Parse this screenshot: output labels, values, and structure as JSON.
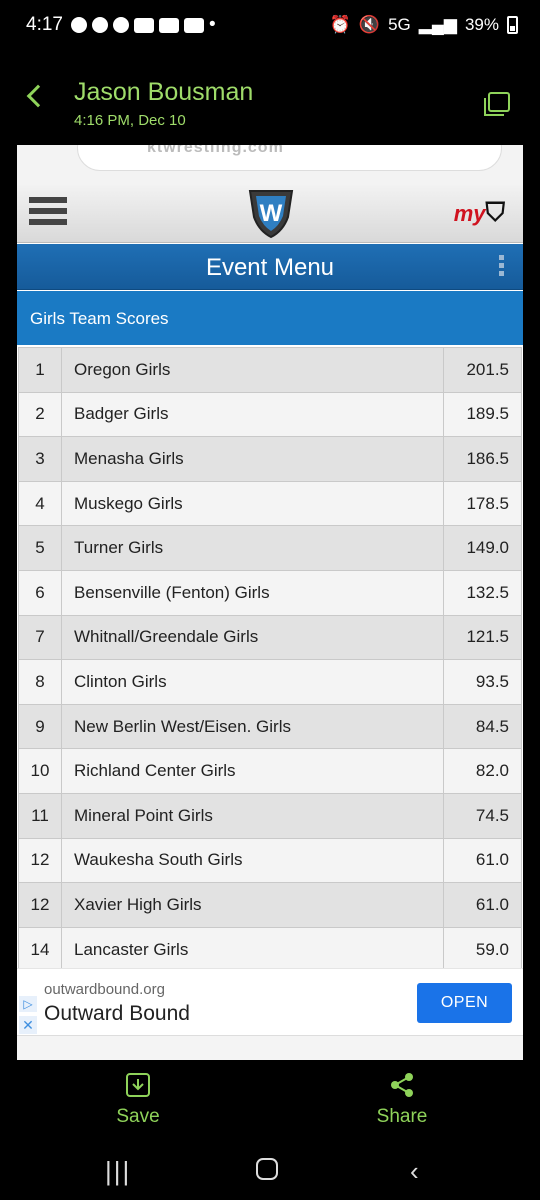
{
  "status": {
    "time": "4:17",
    "dot": "•",
    "network": "5G",
    "battery": "39%"
  },
  "message": {
    "sender": "Jason Bousman",
    "timestamp": "4:16 PM, Dec 10"
  },
  "site": {
    "url_fragment": "ktwrestling.com",
    "logo_text": "my",
    "menu_title": "Event Menu",
    "section_title": "Girls Team Scores"
  },
  "scores": [
    {
      "rank": "1",
      "team": "Oregon Girls",
      "score": "201.5"
    },
    {
      "rank": "2",
      "team": "Badger Girls",
      "score": "189.5"
    },
    {
      "rank": "3",
      "team": "Menasha Girls",
      "score": "186.5"
    },
    {
      "rank": "4",
      "team": "Muskego Girls",
      "score": "178.5"
    },
    {
      "rank": "5",
      "team": "Turner Girls",
      "score": "149.0"
    },
    {
      "rank": "6",
      "team": "Bensenville (Fenton) Girls",
      "score": "132.5"
    },
    {
      "rank": "7",
      "team": "Whitnall/Greendale Girls",
      "score": "121.5"
    },
    {
      "rank": "8",
      "team": "Clinton Girls",
      "score": "93.5"
    },
    {
      "rank": "9",
      "team": "New Berlin West/Eisen. Girls",
      "score": "84.5"
    },
    {
      "rank": "10",
      "team": "Richland Center Girls",
      "score": "82.0"
    },
    {
      "rank": "11",
      "team": "Mineral Point Girls",
      "score": "74.5"
    },
    {
      "rank": "12",
      "team": "Waukesha South Girls",
      "score": "61.0"
    },
    {
      "rank": "12",
      "team": "Xavier High Girls",
      "score": "61.0"
    },
    {
      "rank": "14",
      "team": "Lancaster Girls",
      "score": "59.0"
    }
  ],
  "ad": {
    "domain": "outwardbound.org",
    "title": "Outward Bound",
    "button": "OPEN"
  },
  "actions": {
    "save": "Save",
    "share": "Share"
  },
  "nav": {
    "recent": "|||",
    "back": "‹"
  },
  "colors": {
    "accent": "#8fd35a",
    "event_bar": "#1f6fb5",
    "section_bar": "#1a7ac4",
    "open_button": "#1a73e8"
  }
}
